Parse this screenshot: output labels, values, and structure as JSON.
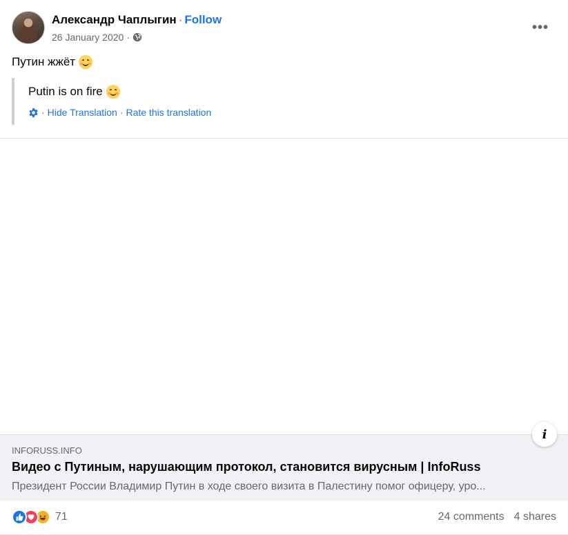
{
  "post": {
    "author": "Александр Чаплыгин",
    "separator": "·",
    "follow_label": "Follow",
    "date": "26 January 2020",
    "meta_separator": "·",
    "privacy_icon": "globe-icon",
    "more_icon": "more-options-icon",
    "more_label": "•••",
    "text": "Путин жжёт",
    "text_emoji": "smiling-face-emoji"
  },
  "translation": {
    "text": "Putin is on fire",
    "settings_icon": "gear-icon",
    "hide_label": "Hide Translation",
    "rate_label": "Rate this translation",
    "sep": "·"
  },
  "link_preview": {
    "info_icon": "info-icon",
    "info_label": "i",
    "domain": "INFORUSS.INFO",
    "title": "Видео с Путиным, нарушающим протокол, становится вирусным | InfoRuss",
    "description": "Президент России Владимир Путин в ходе своего визита в Палестину помог офицеру, уро..."
  },
  "stats": {
    "reactions": [
      "like-icon",
      "love-icon",
      "haha-icon"
    ],
    "reaction_count": "71",
    "comments": "24 comments",
    "shares": "4 shares"
  },
  "colors": {
    "link_blue": "#1b74e4",
    "secondary_text": "#65676b",
    "link_box_bg": "#f0f2f5",
    "like": "#1b74e4",
    "love": "#f33e58",
    "haha": "#f7b125"
  }
}
